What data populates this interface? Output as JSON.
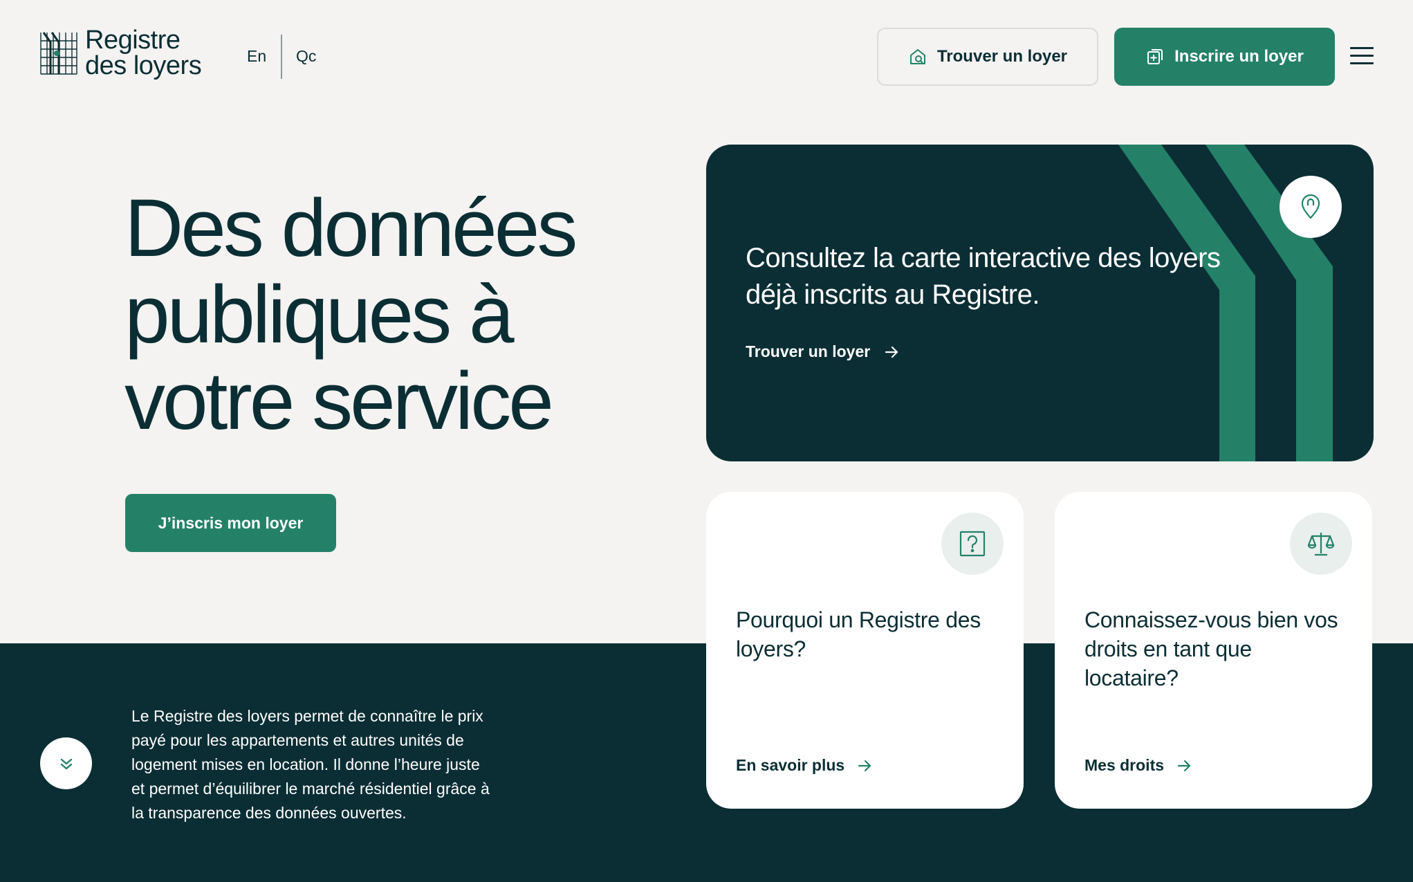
{
  "header": {
    "logo_line1": "Registre",
    "logo_line2": "des loyers",
    "lang_en": "En",
    "lang_qc": "Qc",
    "find_button": "Trouver un loyer",
    "register_button": "Inscrire un loyer",
    "menu_icon": "hamburger-menu-icon"
  },
  "hero": {
    "title_line1": "Des données",
    "title_line2": "publiques à",
    "title_line3": "votre service",
    "cta_label": "J’inscris mon loyer"
  },
  "intro": {
    "text": "Le Registre des loyers permet de connaître le prix payé pour les appartements et autres unités de logement mises en location. Il donne l’heure juste et permet d’équilibrer le marché résidentiel grâce à la transparence des données ouvertes."
  },
  "map_card": {
    "title": "Consultez la carte interactive des loyers déjà inscrits au Registre.",
    "link_label": "Trouver un loyer",
    "icon": "map-pin-icon"
  },
  "cards": [
    {
      "title": "Pourquoi un Registre des loyers?",
      "link_label": "En savoir plus",
      "icon": "question-icon"
    },
    {
      "title": "Connaissez-vous bien vos droits en tant que locataire?",
      "link_label": "Mes droits",
      "icon": "scales-icon"
    }
  ],
  "colors": {
    "primary_green": "#248168",
    "dark_teal": "#0b2e34",
    "background": "#f4f3f1",
    "icon_bg": "#e9efed"
  }
}
